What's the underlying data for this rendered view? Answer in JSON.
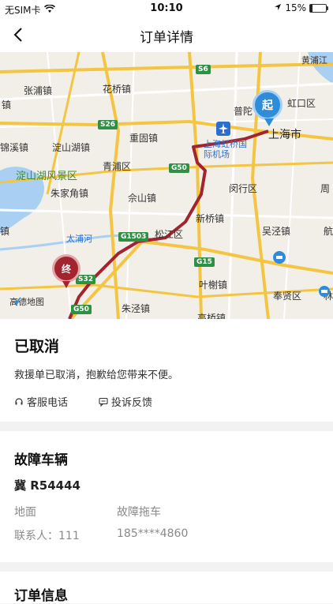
{
  "status_bar": {
    "carrier": "无SIM卡",
    "time": "10:10",
    "battery": "15%",
    "battery_level": 0.15
  },
  "nav": {
    "title": "订单详情"
  },
  "map": {
    "places": {
      "zhangpu": "张浦镇",
      "huaqiao": "花桥镇",
      "puyu": "普陀",
      "hongkou": "虹口区",
      "huangpu": "黄浦江",
      "shanghai": "上海市",
      "zhen1": "镇",
      "dianshanzhen": "淀山湖镇",
      "jinxi": "锦溪镇",
      "chonggu": "重固镇",
      "hongqiao": "上海虹桥国际机场",
      "dianshanhu": "淀山湖风景区",
      "qingpu": "青浦区",
      "zhujiajiao": "朱家角镇",
      "sheshan": "佘山镇",
      "minhang": "闵行区",
      "zhou": "周",
      "xinqiao": "新桥镇",
      "dapuhe": "太浦河",
      "songjiang": "松江区",
      "wujing": "吴泾镇",
      "hang": "航",
      "yexie": "叶榭镇",
      "fengxian": "奉贤区",
      "zhujing": "朱泾镇",
      "lin": "林",
      "qian": "镇",
      "gaoqiao": "高桥镇"
    },
    "roads": {
      "s6": "S6",
      "s26": "S26",
      "g50a": "G50",
      "g1503": "G1503",
      "g15": "G15",
      "s32": "S32",
      "g50b": "G50"
    },
    "start_marker": "起",
    "end_marker": "终",
    "logo": "高德地图",
    "route_color": "#a2242e"
  },
  "order_status": {
    "title": "已取消",
    "description": "救援单已取消，抱歉给您带来不便。",
    "phone_label": "客服电话",
    "complaint_label": "投诉反馈"
  },
  "vehicle": {
    "section_title": "故障车辆",
    "plate": "冀 R54444",
    "location": "地面",
    "service": "故障拖车",
    "contact": "联系人：111",
    "phone": "185****4860"
  },
  "order_info": {
    "section_title": "订单信息"
  }
}
